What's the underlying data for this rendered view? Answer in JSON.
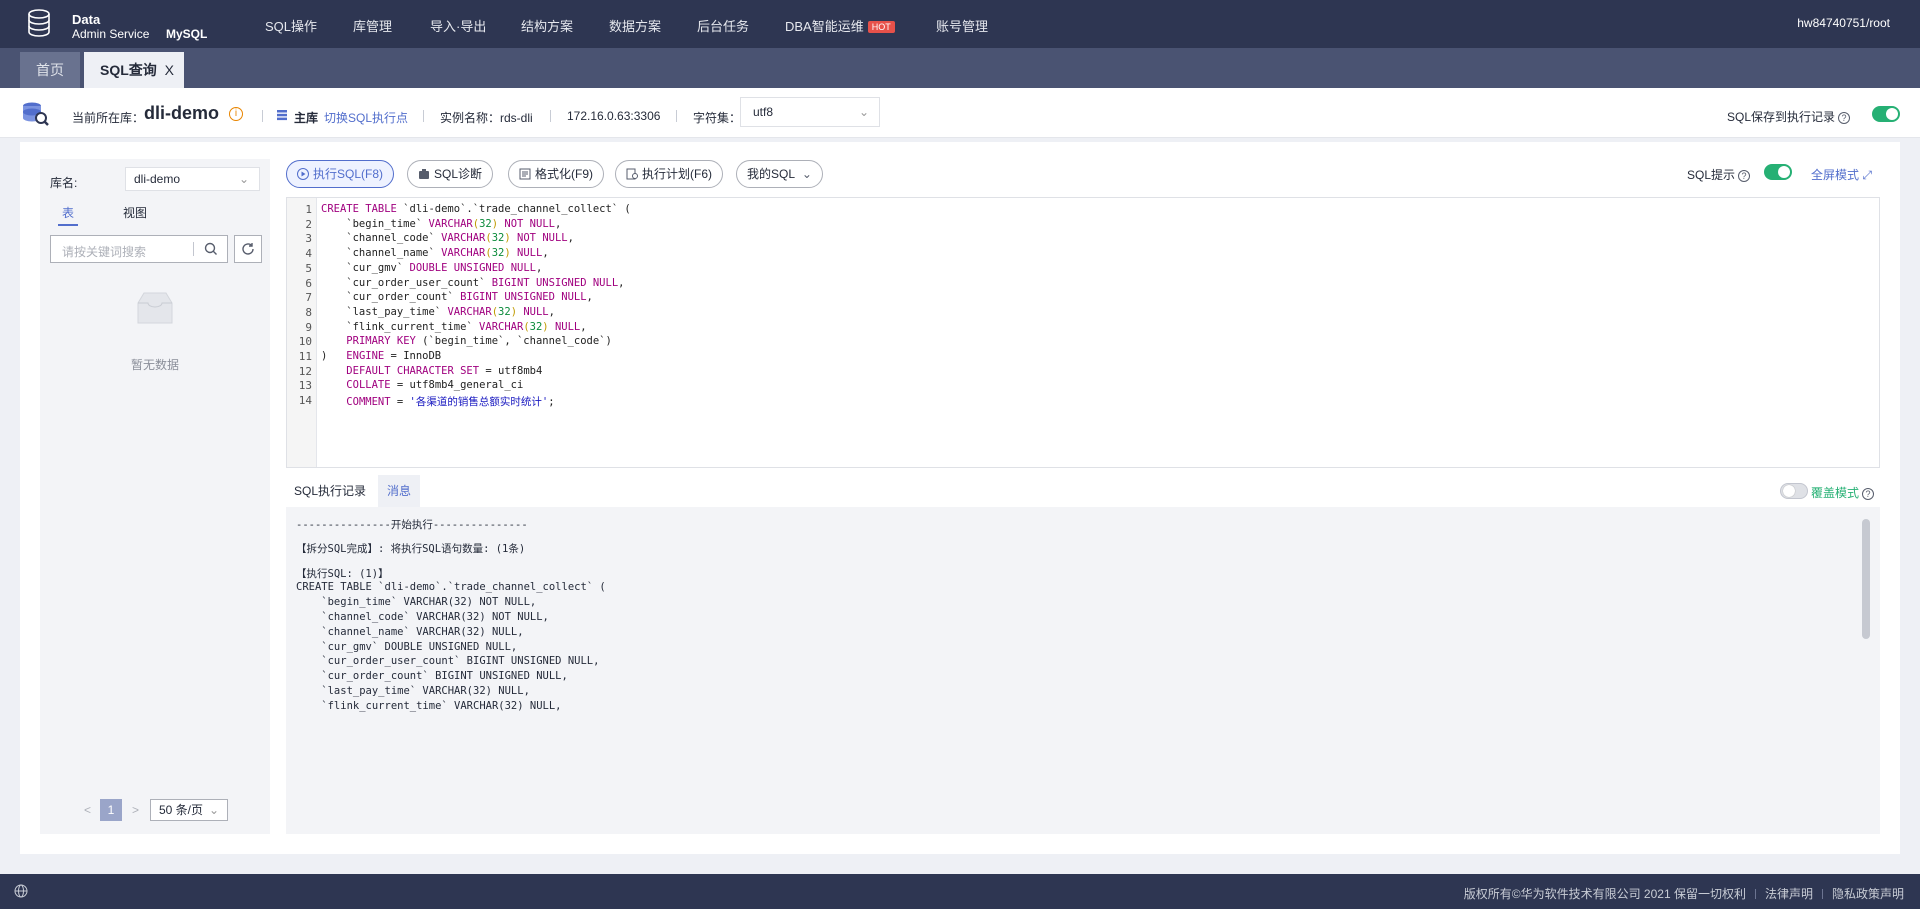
{
  "header": {
    "brand_line1": "Data",
    "brand_line2": "Admin Service",
    "brand_engine": "MySQL",
    "nav": [
      "SQL操作",
      "库管理",
      "导入·导出",
      "结构方案",
      "数据方案",
      "后台任务",
      "DBA智能运维",
      "账号管理"
    ],
    "hot_badge": "HOT",
    "user": "hw84740751/root"
  },
  "tabs": {
    "home": "首页",
    "active": "SQL查询",
    "close": "X"
  },
  "infobar": {
    "current_db_label": "当前所在库：",
    "db_name": "dli-demo",
    "warn_glyph": "i",
    "role": "主库",
    "switch_link": "切换SQL执行点",
    "instance_label": "实例名称：rds-dli",
    "address": "172.16.0.63:3306",
    "charset_label": "字符集：",
    "charset_value": "utf8",
    "save_record_label": "SQL保存到执行记录",
    "save_record_on": true
  },
  "left_panel": {
    "db_label": "库名:",
    "db_select": "dli-demo",
    "tab_table": "表",
    "tab_view": "视图",
    "search_placeholder": "请按关键词搜索",
    "empty_text": "暂无数据",
    "page_prev": "<",
    "page_current": "1",
    "page_next": ">",
    "page_size": "50 条/页"
  },
  "toolbar": {
    "execute": "执行SQL(F8)",
    "diagnose": "SQL诊断",
    "format": "格式化(F9)",
    "plan": "执行计划(F6)",
    "my_sql": "我的SQL",
    "sql_tip_label": "SQL提示",
    "sql_tip_on": true,
    "fullscreen": "全屏模式"
  },
  "editor": {
    "line_numbers": [
      "1",
      "2",
      "3",
      "4",
      "5",
      "6",
      "7",
      "8",
      "9",
      "10",
      "11",
      "12",
      "13",
      "14"
    ],
    "lines": [
      "CREATE TABLE `dli-demo`.`trade_channel_collect` (",
      "    `begin_time` VARCHAR(32) NOT NULL,",
      "    `channel_code` VARCHAR(32) NOT NULL,",
      "    `channel_name` VARCHAR(32) NULL,",
      "    `cur_gmv` DOUBLE UNSIGNED NULL,",
      "    `cur_order_user_count` BIGINT UNSIGNED NULL,",
      "    `cur_order_count` BIGINT UNSIGNED NULL,",
      "    `last_pay_time` VARCHAR(32) NULL,",
      "    `flink_current_time` VARCHAR(32) NULL,",
      "    PRIMARY KEY (`begin_time`, `channel_code`)",
      ")   ENGINE = InnoDB",
      "    DEFAULT CHARACTER SET = utf8mb4",
      "    COLLATE = utf8mb4_general_ci",
      "    COMMENT = '各渠道的销售总额实时统计';"
    ]
  },
  "log": {
    "tab_history": "SQL执行记录",
    "tab_message": "消息",
    "cover_mode_label": "覆盖模式",
    "cover_mode_on": false,
    "lines": [
      "---------------开始执行---------------",
      "【拆分SQL完成】: 将执行SQL语句数量: (1条)",
      "【执行SQL: (1)】",
      "CREATE TABLE `dli-demo`.`trade_channel_collect` (",
      "    `begin_time` VARCHAR(32) NOT NULL,",
      "    `channel_code` VARCHAR(32) NOT NULL,",
      "    `channel_name` VARCHAR(32) NULL,",
      "    `cur_gmv` DOUBLE UNSIGNED NULL,",
      "    `cur_order_user_count` BIGINT UNSIGNED NULL,",
      "    `cur_order_count` BIGINT UNSIGNED NULL,",
      "    `last_pay_time` VARCHAR(32) NULL,",
      "    `flink_current_time` VARCHAR(32) NULL,"
    ]
  },
  "footer": {
    "copyright": "版权所有©华为软件技术有限公司 2021 保留一切权利",
    "legal": "法律声明",
    "privacy": "隐私政策声明"
  },
  "colors": {
    "nav_bg": "#2e3652",
    "tab_bg": "#4a5372",
    "accent": "#526ecc",
    "toggle_on": "#26b074",
    "hot": "#e7514a"
  }
}
